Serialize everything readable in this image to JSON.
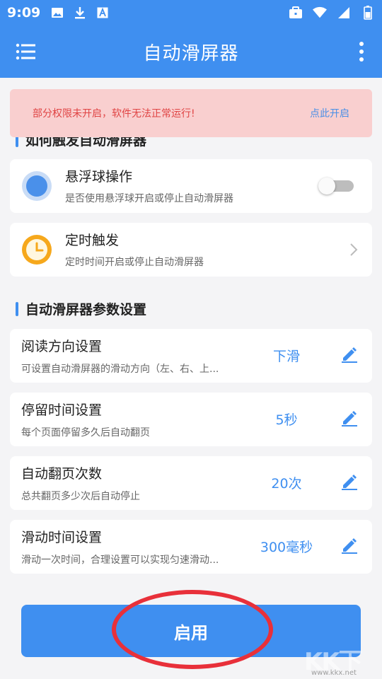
{
  "status_bar": {
    "time": "9:09",
    "left_icons": [
      "image-icon",
      "download-icon",
      "font-icon"
    ],
    "right_icons": [
      "briefcase-icon",
      "wifi-icon",
      "signal-icon",
      "battery-icon"
    ]
  },
  "app_bar": {
    "title": "自动滑屏器",
    "menu_icon": "menu-icon",
    "more_icon": "more-vert-icon"
  },
  "warning": {
    "message": "部分权限未开启，软件无法正常运行!",
    "action": "点此开启"
  },
  "section_trigger": {
    "title": "如何触发自动滑屏器",
    "items": [
      {
        "title": "悬浮球操作",
        "subtitle": "是否使用悬浮球开启或停止自动滑屏器",
        "icon": "floating-ball-icon",
        "toggle_on": false
      },
      {
        "title": "定时触发",
        "subtitle": "定时时间开启或停止自动滑屏器",
        "icon": "clock-icon"
      }
    ]
  },
  "section_params": {
    "title": "自动滑屏器参数设置",
    "items": [
      {
        "title": "阅读方向设置",
        "subtitle": "可设置自动滑屏器的滑动方向（左、右、上...",
        "value": "下滑"
      },
      {
        "title": "停留时间设置",
        "subtitle": "每个页面停留多久后自动翻页",
        "value": "5秒"
      },
      {
        "title": "自动翻页次数",
        "subtitle": "总共翻页多少次后自动停止",
        "value": "20次"
      },
      {
        "title": "滑动时间设置",
        "subtitle": "滑动一次时间，合理设置可以实现匀速滑动...",
        "value": "300毫秒"
      }
    ]
  },
  "start_button": {
    "label": "启用"
  },
  "watermark": {
    "brand": "KK下载",
    "url": "www.kkx.net"
  },
  "colors": {
    "primary": "#3f8ff0",
    "warning_bg": "#f9cfcf",
    "warning_text": "#e04444",
    "annotation_ring": "#e8303a"
  }
}
